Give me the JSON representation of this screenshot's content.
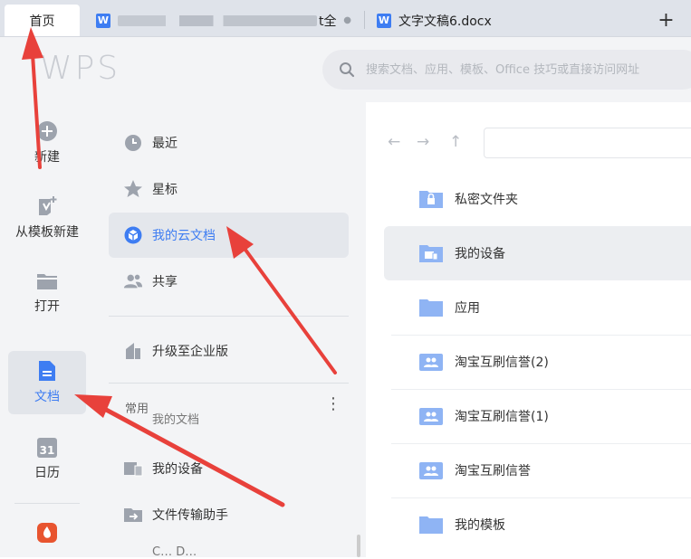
{
  "tabs": {
    "home": "首页",
    "doc1_tail": "t全",
    "doc2": "文字文稿6.docx",
    "doc_icon_letter": "W",
    "new_tab": "+"
  },
  "header": {
    "logo": "WPS",
    "search_placeholder": "搜索文档、应用、模板、Office 技巧或直接访问网址"
  },
  "rail": {
    "items": [
      {
        "label": "新建",
        "icon": "plus-circle-icon"
      },
      {
        "label": "从模板新建",
        "icon": "template-icon"
      },
      {
        "label": "打开",
        "icon": "folder-icon"
      },
      {
        "label": "文档",
        "icon": "document-icon"
      },
      {
        "label": "日历",
        "icon": "calendar-icon"
      },
      {
        "label": "",
        "icon": "app-icon"
      }
    ],
    "calendar_day": "31"
  },
  "sidebar": {
    "items": [
      {
        "label": "最近",
        "icon": "clock-icon"
      },
      {
        "label": "星标",
        "icon": "star-icon"
      },
      {
        "label": "我的云文档",
        "icon": "cloud-cube-icon"
      },
      {
        "label": "共享",
        "icon": "people-icon"
      },
      {
        "label": "升级至企业版",
        "icon": "building-icon"
      }
    ],
    "section_label": "常用",
    "more": "⋮",
    "ghost": "我的文档",
    "frequent": [
      {
        "label": "我的设备",
        "icon": "device-icon"
      },
      {
        "label": "文件传输助手",
        "icon": "transfer-icon"
      }
    ],
    "cut_off": "C… D…"
  },
  "main": {
    "files": [
      {
        "name": "私密文件夹",
        "icon": "lock-folder-icon"
      },
      {
        "name": "我的设备",
        "icon": "device-folder-icon"
      },
      {
        "name": "应用",
        "icon": "folder-icon"
      },
      {
        "name": "淘宝互刷信誉(2)",
        "icon": "shared-folder-icon"
      },
      {
        "name": "淘宝互刷信誉(1)",
        "icon": "shared-folder-icon"
      },
      {
        "name": "淘宝互刷信誉",
        "icon": "shared-folder-icon"
      },
      {
        "name": "我的模板",
        "icon": "folder-icon"
      }
    ]
  },
  "colors": {
    "accent": "#3e7df2",
    "folder": "#8fb4f4",
    "annotation_arrow": "#e8413b"
  }
}
